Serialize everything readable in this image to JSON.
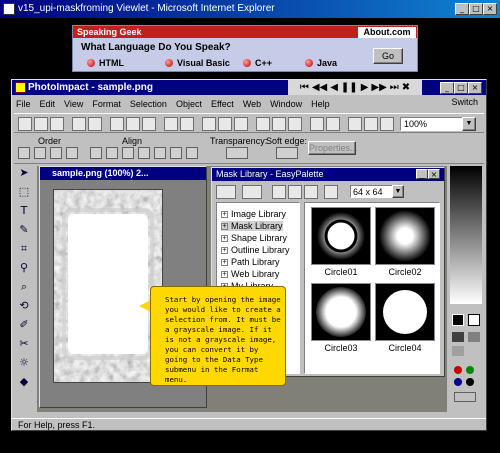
{
  "browser": {
    "title": "v15_upi-maskfroming Viewlet - Microsoft Internet Explorer",
    "min": "_",
    "max": "□",
    "close": "×"
  },
  "ad": {
    "brand": "Speaking Geek",
    "logo": "About.com",
    "question": "What Language Do You Speak?",
    "options": [
      "HTML",
      "Visual Basic",
      "C++",
      "Java"
    ],
    "go": "Go"
  },
  "app": {
    "title": "PhotoImpact - sample.png",
    "menu": [
      "File",
      "Edit",
      "View",
      "Format",
      "Selection",
      "Object",
      "Effect",
      "Web",
      "Window",
      "Help"
    ],
    "switch": "Switch",
    "media": [
      "⏮",
      "◀◀",
      "◀",
      "❚❚",
      "▶",
      "▶▶",
      "⏭",
      "✖"
    ],
    "zoom": "100%",
    "labels": {
      "order": "Order",
      "align": "Align",
      "transparency": "Transparency:",
      "soft_edge": "Soft edge:",
      "properties": "Properties..."
    },
    "doc_title": "sample.png (100%) 2...",
    "palette": {
      "title": "Mask Library - EasyPalette",
      "size": "64 x 64",
      "tree": [
        "Image Library",
        "Mask Library",
        "Shape Library",
        "Outline Library",
        "Path Library",
        "Web Library",
        "My Library"
      ],
      "thumbs": [
        "Circle01",
        "Circle02",
        "Circle03",
        "Circle04"
      ]
    },
    "callout": "Start by opening the image you would like to create a selection from. It must be a grayscale image. If it is not a grayscale image, you can convert it by going to the Data Type submenu in the Format menu.",
    "status": "For Help, press F1."
  }
}
